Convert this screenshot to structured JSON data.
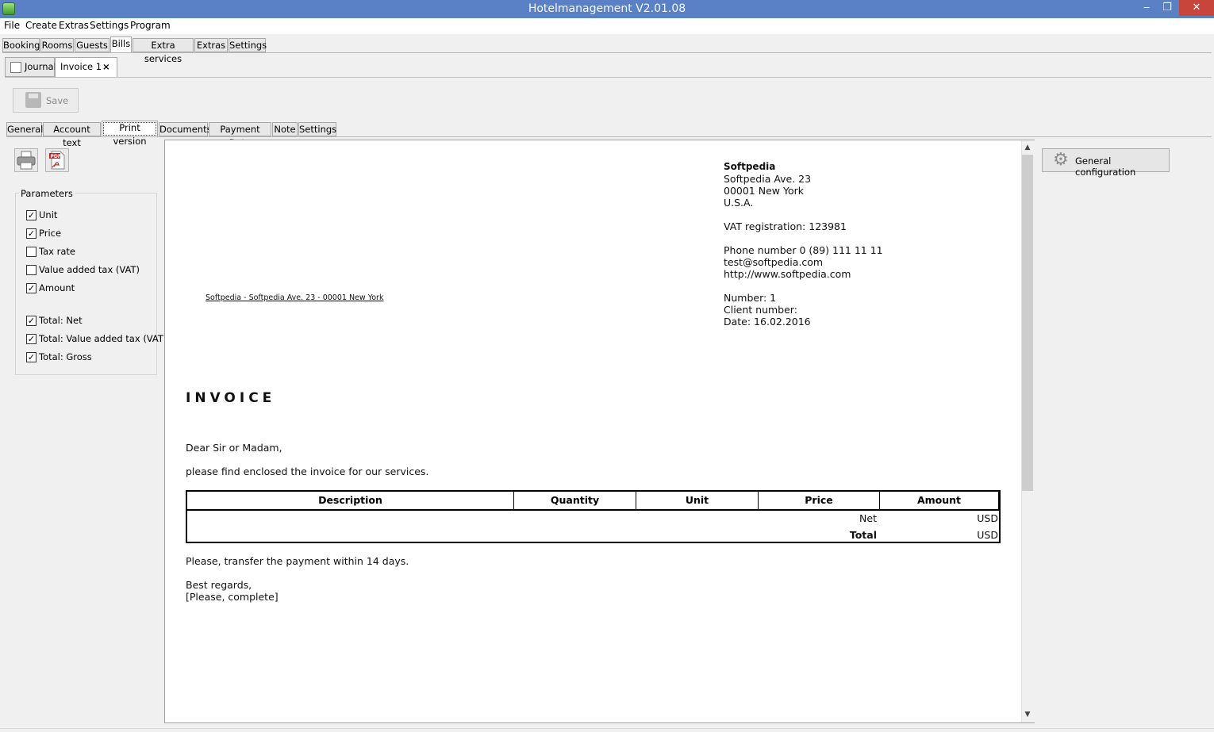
{
  "window": {
    "title": "Hotelmanagement V2.01.08",
    "min_icon": "‒",
    "max_icon": "❐",
    "close_icon": "✕"
  },
  "menu": [
    "File",
    "Create",
    "Extras",
    "Settings",
    "Program"
  ],
  "main_tabs": [
    "Booking",
    "Rooms",
    "Guests",
    "Bills",
    "Extra services",
    "Extras",
    "Settings"
  ],
  "doc_tabs": {
    "journal": "Journal",
    "invoice": "Invoice 1",
    "close_icon": "×"
  },
  "toolbar": {
    "save_label": "Save"
  },
  "sub_tabs": [
    "General",
    "Account text",
    "Print version",
    "Documents",
    "Payment Data",
    "Note",
    "Settings"
  ],
  "parameters": {
    "title": "Parameters",
    "items": [
      {
        "label": "Unit",
        "checked": true
      },
      {
        "label": "Price",
        "checked": true
      },
      {
        "label": "Tax rate",
        "checked": false
      },
      {
        "label": "Value added tax (VAT)",
        "checked": false
      },
      {
        "label": "Amount",
        "checked": true
      },
      {
        "label": "Total: Net",
        "checked": true
      },
      {
        "label": "Total: Value added tax (VAT)",
        "checked": true
      },
      {
        "label": "Total: Gross",
        "checked": true
      }
    ]
  },
  "invoice": {
    "sender_line": "Softpedia - Softpedia Ave. 23 - 00001 New York",
    "company": "Softpedia",
    "address1": "Softpedia Ave. 23",
    "address2": "00001 New York",
    "country": "U.S.A.",
    "vat": "VAT registration: 123981",
    "phone": "Phone number 0 (89) 111 11 11",
    "email": "test@softpedia.com",
    "web": "http://www.softpedia.com",
    "number": "Number: 1",
    "client": "Client number:",
    "date": "Date: 16.02.2016",
    "heading": "INVOICE",
    "salutation": "Dear Sir or Madam,",
    "intro": "please find enclosed the invoice for our services.",
    "table": {
      "headers": [
        "Description",
        "Quantity",
        "Unit",
        "Price",
        "Amount"
      ],
      "net_label": "Net",
      "net_value": "USD",
      "total_label": "Total",
      "total_value": "USD"
    },
    "payment_note": "Please, transfer the payment within 14 days.",
    "closing": "Best regards,",
    "signature": "[Please, complete]"
  },
  "right_panel": {
    "general_config": "General configuration"
  }
}
